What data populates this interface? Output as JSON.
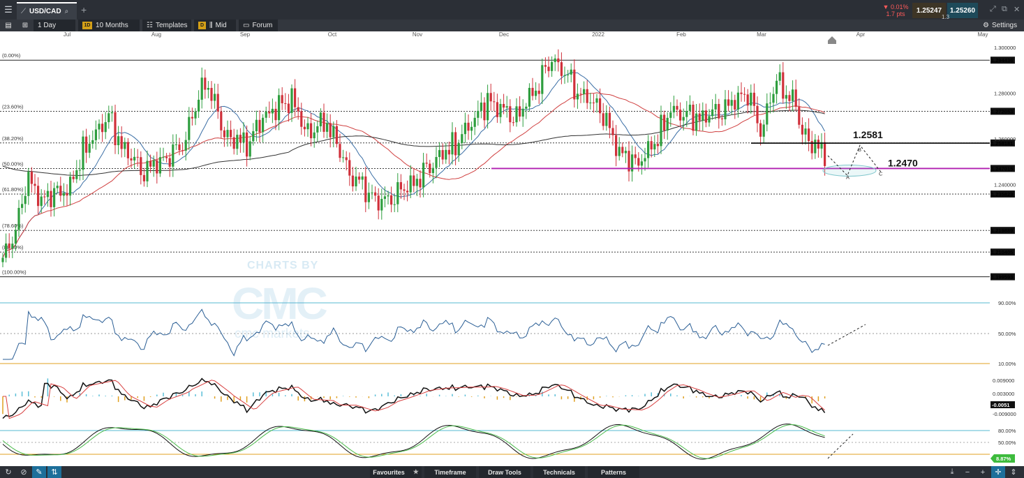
{
  "topbar": {
    "menu_icon": "hamburger-menu-icon",
    "tab_symbol": "USD/CAD",
    "tab_icon": "chart-line-icon",
    "search_icon": "search-icon",
    "add_tab_icon": "plus-icon",
    "change_pct": "0.01%",
    "change_pts": "1.7 pts",
    "bid": "1.25247",
    "spread": "1.3",
    "ask": "1.25260",
    "window_icons": [
      "expand-icon",
      "detach-icon",
      "close-icon"
    ]
  },
  "toolbar": {
    "layout_icon": "panel-icon",
    "grid_icon": "grid-icon",
    "interval": "1 Day",
    "range_badge": "1D",
    "range": "10 Months",
    "templates_label": "Templates",
    "price_badge": "D",
    "price_type": "Mid",
    "forum_label": "Forum",
    "settings_label": "Settings"
  },
  "chart_data": {
    "type": "candlestick",
    "months": [
      "Jul",
      "Aug",
      "Sep",
      "Oct",
      "Nov",
      "Dec",
      "2022",
      "Feb",
      "Mar",
      "Apr",
      "May"
    ],
    "y_axis_ticks": [
      "1.300000",
      "1.280000",
      "1.260000",
      "1.240000"
    ],
    "ylim": [
      1.1955,
      1.3055
    ],
    "fib_levels": [
      {
        "label": "(0.00%)",
        "price": 1.294436,
        "tag": "1.294436"
      },
      {
        "label": "(23.60%)",
        "price": 1.272053,
        "tag": "1.272053"
      },
      {
        "label": "(38.20%)",
        "price": 1.258181,
        "tag": "1.258181"
      },
      {
        "label": "(50.00%)",
        "price": 1.247015,
        "tag": "1.247015"
      },
      {
        "label": "(61.80%)",
        "price": 1.235823,
        "tag": "1.235823"
      },
      {
        "label": "(78.60%)",
        "price": 1.219889,
        "tag": "1.219889"
      },
      {
        "label": "(88.60%)",
        "price": 1.210405,
        "tag": "1.210405"
      },
      {
        "label": "(100.00%)",
        "price": 1.199593,
        "tag": "1.199593"
      }
    ],
    "annotations": [
      {
        "text": "1.2581",
        "price": 1.2581
      },
      {
        "text": "1.2470",
        "price": 1.247
      }
    ],
    "pattern_points": [
      "A",
      "B",
      "C"
    ],
    "rsi": {
      "levels": [
        "90.00%",
        "50.00%",
        "10.00%"
      ]
    },
    "macd": {
      "ticks": [
        "0.009000",
        "0.003000",
        "-0.009000"
      ],
      "current_tag": "-0.0051",
      "current_color": "#ffffff"
    },
    "stochastic": {
      "ticks": [
        "80.00%",
        "50.00%"
      ],
      "current_tag": "8.87%"
    },
    "watermark": {
      "top": "CHARTS BY",
      "logo": "CMC",
      "bottom": "cmc markets"
    },
    "colors": {
      "up": "#2e9e3e",
      "down": "#d0303a",
      "ma_fast": "#3a6ea5",
      "ma_mid": "#d04040",
      "ma_slow": "#333333",
      "support": "#b01fb0"
    }
  },
  "bottombar": {
    "left_icons": [
      "refresh-icon",
      "no-entry-icon",
      "pencil-icon",
      "crosshair-cursor-icon"
    ],
    "favourites_label": "Favourites",
    "star_icon": "star-icon",
    "timeframe_label": "Timeframe",
    "draw_tools_label": "Draw Tools",
    "technicals_label": "Technicals",
    "patterns_label": "Patterns",
    "right_icons": [
      "export-icon",
      "zoom-out-icon",
      "zoom-in-icon",
      "move-icon",
      "resize-icon"
    ]
  }
}
